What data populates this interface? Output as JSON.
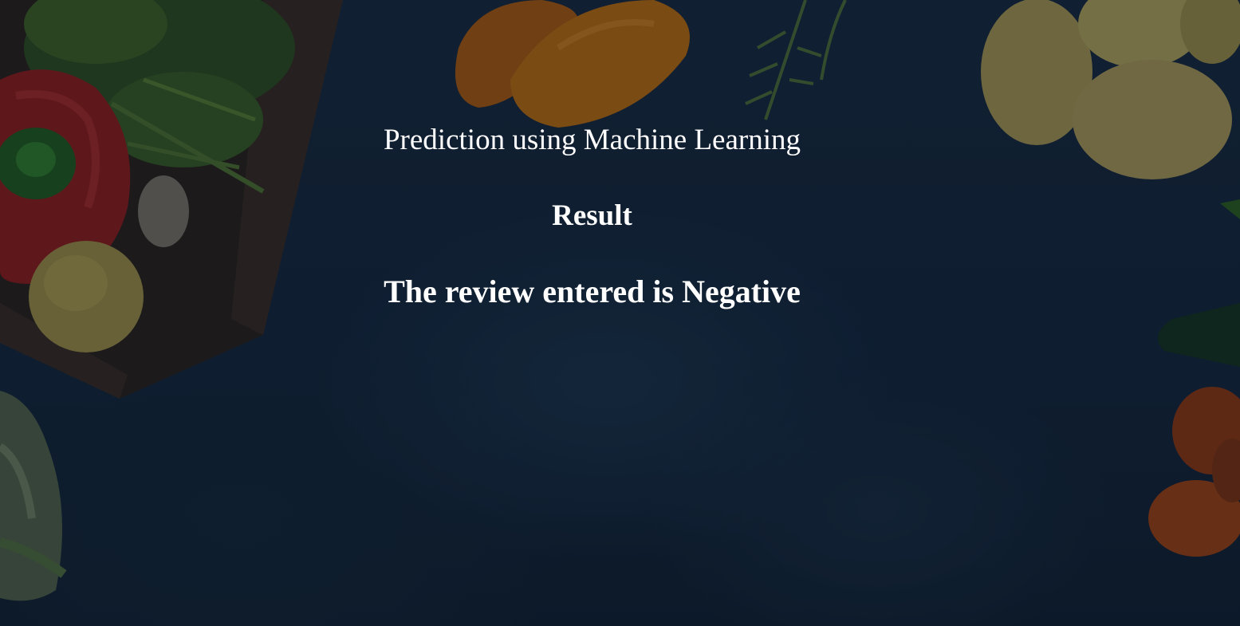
{
  "page": {
    "title": "Prediction using Machine Learning",
    "result_heading": "Result",
    "result_text": "The review entered is Negative"
  },
  "background": {
    "description_icon": "vegetables-background-image",
    "colors": {
      "base": "#14253a",
      "text": "#ffffff"
    }
  }
}
